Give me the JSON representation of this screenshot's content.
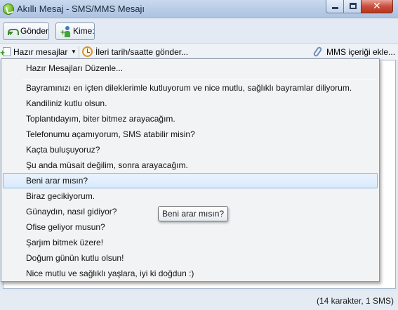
{
  "window": {
    "title": "Akıllı Mesaj - SMS/MMS Mesajı",
    "icon": "app-check-icon"
  },
  "toolbar": {
    "send_label": "Gönder",
    "to_label": "Kime:"
  },
  "toolbar2": {
    "templates_label": "Hazır mesajlar",
    "schedule_label": "İleri tarih/saatte gönder...",
    "mms_label": "MMS içeriği ekle..."
  },
  "menu": {
    "edit_label": "Hazır Mesajları Düzenle...",
    "items": [
      "Bayramınızı en içten dileklerimle kutluyorum ve nice mutlu, sağlıklı bayramlar diliyorum.",
      "Kandiliniz kutlu olsun.",
      "Toplantıdayım, biter bitmez arayacağım.",
      "Telefonumu açamıyorum, SMS atabilir misin?",
      "Kaçta buluşuyoruz?",
      "Şu anda müsait değilim, sonra arayacağım.",
      "Beni arar mısın?",
      "Biraz gecikiyorum.",
      "Günaydın, nasıl gidiyor?",
      "Ofise geliyor musun?",
      "Şarjım bitmek üzere!",
      "Doğum günün kutlu olsun!",
      "Nice mutlu ve sağlıklı yaşlara, iyi ki doğdun :)"
    ],
    "highlighted_index": 6
  },
  "tooltip": "Beni arar mısın?",
  "status": "(14 karakter, 1 SMS)"
}
